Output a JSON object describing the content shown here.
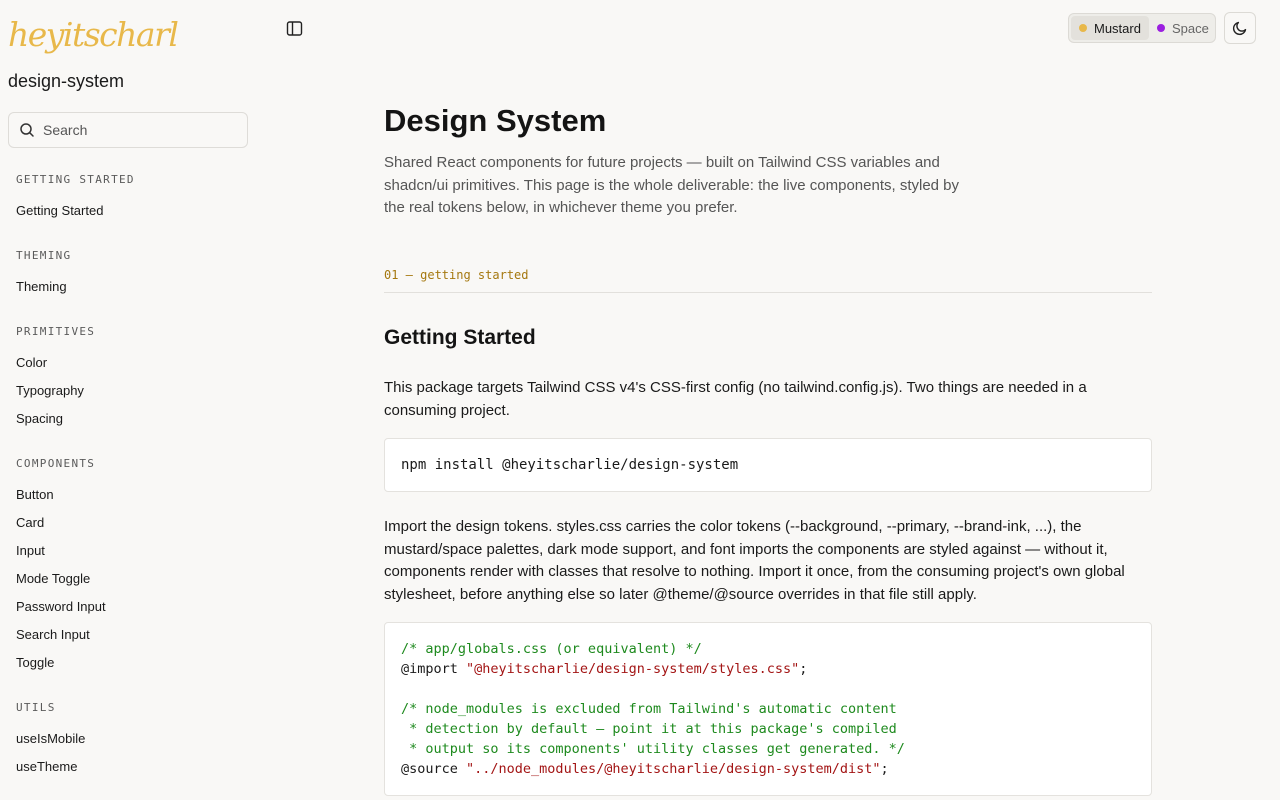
{
  "brand": {
    "logo_text": "heyitscharlie",
    "package_name": "design-system",
    "logo_color": "#e8b84a"
  },
  "search": {
    "placeholder": "Search"
  },
  "nav": {
    "groups": [
      {
        "title": "GETTING STARTED",
        "items": [
          "Getting Started"
        ]
      },
      {
        "title": "THEMING",
        "items": [
          "Theming"
        ]
      },
      {
        "title": "PRIMITIVES",
        "items": [
          "Color",
          "Typography",
          "Spacing"
        ]
      },
      {
        "title": "COMPONENTS",
        "items": [
          "Button",
          "Card",
          "Input",
          "Mode Toggle",
          "Password Input",
          "Search Input",
          "Toggle"
        ]
      },
      {
        "title": "UTILS",
        "items": [
          "useIsMobile",
          "useTheme"
        ]
      }
    ]
  },
  "header": {
    "themes": [
      {
        "label": "Mustard",
        "color": "#e8b84a",
        "active": true
      },
      {
        "label": "Space",
        "color": "#9b1fe0",
        "active": false
      }
    ],
    "mode_icon": "moon-icon",
    "sidebar_toggle_icon": "sidebar-panel-icon"
  },
  "main": {
    "title": "Design System",
    "description": "Shared React components for future projects — built on Tailwind CSS variables and shadcn/ui primitives. This page is the whole deliverable: the live components, styled by the real tokens below, in whichever theme you prefer.",
    "section_label": "01 — getting started",
    "section_title": "Getting Started",
    "intro": "This package targets Tailwind CSS v4's CSS-first config (no tailwind.config.js). Two things are needed in a consuming project.",
    "install_command": "npm install @heyitscharlie/design-system",
    "import_text": "Import the design tokens. styles.css carries the color tokens (--background, --primary, --brand-ink, ...), the mustard/space palettes, dark mode support, and font imports the components are styled against — without it, components render with classes that resolve to nothing. Import it once, from the consuming project's own global stylesheet, before anything else so later @theme/@source overrides in that file still apply.",
    "code_lines": [
      {
        "comment": "/* app/globals.css (or equivalent) */"
      },
      {
        "keyword": "@import ",
        "string": "\"@heyitscharlie/design-system/styles.css\"",
        "punct": ";"
      },
      {
        "blank": ""
      },
      {
        "comment": "/* node_modules is excluded from Tailwind's automatic content"
      },
      {
        "comment": " * detection by default — point it at this package's compiled"
      },
      {
        "comment": " * output so its components' utility classes get generated. */"
      },
      {
        "keyword": "@source ",
        "string": "\"../node_modules/@heyitscharlie/design-system/dist\"",
        "punct": ";"
      }
    ]
  },
  "colors": {
    "background": "#f9f8f6",
    "accent": "#a5780f",
    "comment": "#1e8a1e",
    "string": "#a31515"
  }
}
